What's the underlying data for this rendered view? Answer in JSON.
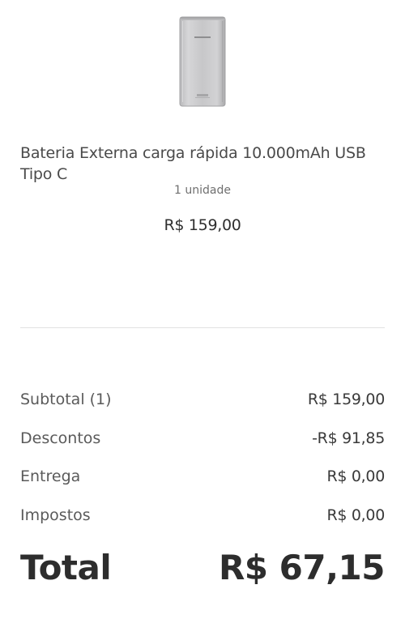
{
  "product": {
    "name": "Bateria Externa carga rápida 10.000mAh USB Tipo C",
    "quantity": "1 unidade",
    "price": "R$ 159,00",
    "image_icon": "power-bank-image"
  },
  "summary": {
    "subtotal_label": "Subtotal (1)",
    "subtotal_value": "R$ 159,00",
    "discounts_label": "Descontos",
    "discounts_value": "-R$ 91,85",
    "delivery_label": "Entrega",
    "delivery_value": "R$ 0,00",
    "taxes_label": "Impostos",
    "taxes_value": "R$ 0,00",
    "total_label": "Total",
    "total_value": "R$ 67,15"
  }
}
